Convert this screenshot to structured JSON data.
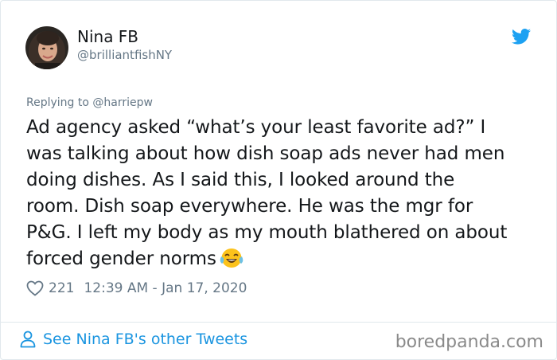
{
  "user": {
    "name": "Nina FB",
    "handle": "@brilliantfishNY"
  },
  "tweet": {
    "replying_to": "Replying to @harriepw",
    "lines": [
      "Ad agency asked “what’s your least favorite ad?” I",
      "was talking about how dish soap ads never had men",
      "doing dishes. As I said this, I looked around the",
      "room. Dish soap everywhere. He was the mgr for",
      "P&G. I left my body as my mouth blathered on about",
      "forced gender norms"
    ],
    "emoji": "crying-laughing-emoji",
    "likes": "221",
    "timestamp": "12:39 AM - Jan 17, 2020"
  },
  "footer": {
    "link_label": "See Nina FB's other Tweets",
    "watermark": "boredpanda.com"
  },
  "colors": {
    "twitter_blue": "#1da1f2",
    "link_blue": "#1b95e0",
    "secondary_text": "#657786",
    "primary_text": "#14171a",
    "border": "#e1e8ed"
  }
}
